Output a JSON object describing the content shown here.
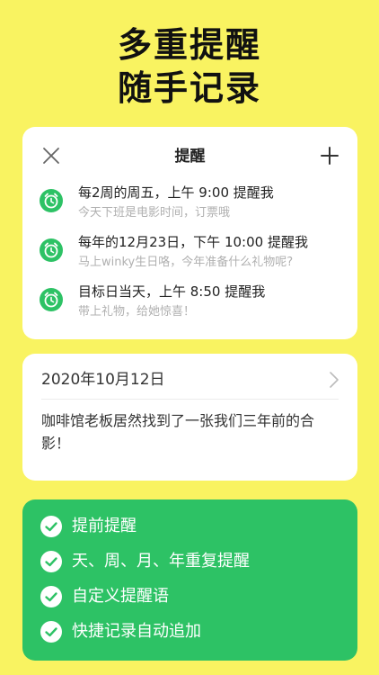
{
  "headline": [
    "多重提醒",
    "随手记录"
  ],
  "reminder_card": {
    "title": "提醒",
    "items": [
      {
        "main": "每2周的周五，上午 9:00 提醒我",
        "sub": "今天下班是电影时间，订票哦"
      },
      {
        "main": "每年的12月23日，下午 10:00 提醒我",
        "sub": "马上winky生日咯，今年准备什么礼物呢?"
      },
      {
        "main": "目标日当天，上午 8:50 提醒我",
        "sub": "带上礼物，给她惊喜！"
      }
    ]
  },
  "note_card": {
    "date": "2020年10月12日",
    "body": "咖啡馆老板居然找到了一张我们三年前的合影！"
  },
  "features": [
    "提前提醒",
    "天、周、月、年重复提醒",
    "自定义提醒语",
    "快捷记录自动追加"
  ],
  "colors": {
    "background": "#f9f361",
    "accent_green": "#2dc265",
    "card": "#ffffff"
  },
  "icons": {
    "close": "close-icon",
    "add": "plus-icon",
    "alarm": "alarm-clock-icon",
    "chevron": "chevron-right-icon",
    "check": "check-circle-icon"
  }
}
